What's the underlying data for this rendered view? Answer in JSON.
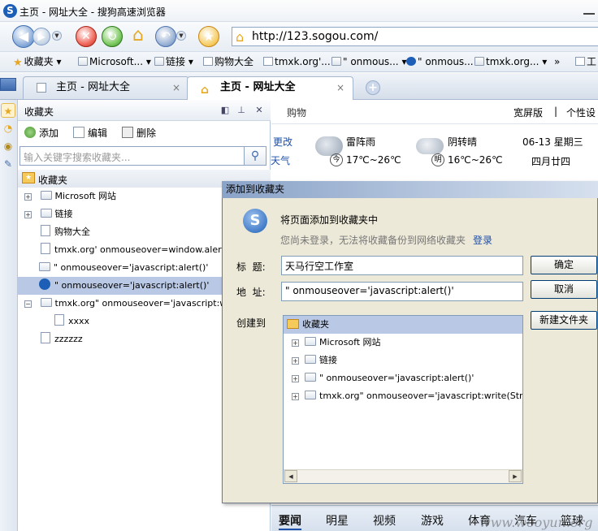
{
  "window": {
    "title": "主页 - 网址大全 - 搜狗高速浏览器"
  },
  "address": {
    "url": "http://123.sogou.com/"
  },
  "favbar": {
    "items": [
      "收藏夹",
      "Microsoft...",
      "链接",
      "购物大全",
      "tmxk.org'...",
      "\" onmous...",
      "\" onmous...",
      "tmxk.org...",
      "工"
    ]
  },
  "tabs": [
    {
      "label": "主页 - 网址大全",
      "close": "×"
    },
    {
      "label": "主页 - 网址大全",
      "close": "×"
    }
  ],
  "panel": {
    "title": "收藏夹",
    "tools": {
      "add": "添加",
      "edit": "编辑",
      "delete": "删除"
    },
    "search_placeholder": "输入关键字搜索收藏夹...",
    "root": "收藏夹",
    "items": [
      {
        "label": "Microsoft 网站",
        "kind": "folder",
        "expander": "+"
      },
      {
        "label": "链接",
        "kind": "folder",
        "expander": "+"
      },
      {
        "label": "购物大全",
        "kind": "page"
      },
      {
        "label": "tmxk.org' onmouseover=window.alert('chro",
        "kind": "page"
      },
      {
        "label": "\" onmouseover='javascript:alert()'",
        "kind": "folder"
      },
      {
        "label": "\" onmouseover='javascript:alert()'",
        "kind": "sogou",
        "selected": true
      },
      {
        "label": "tmxk.org\" onmouseover='javascript:write(S",
        "kind": "folder",
        "expander": "−"
      },
      {
        "label": "xxxx",
        "kind": "page",
        "indent": true
      },
      {
        "label": "zzzzzz",
        "kind": "page"
      }
    ]
  },
  "content": {
    "shopping": "购物",
    "wide": "宽屏版",
    "separator": "|",
    "personal": "个性设",
    "change": "更改",
    "weather_label": "天气",
    "day1": {
      "cond": "雷阵雨",
      "badge": "今",
      "temp": "17℃~26℃"
    },
    "day2": {
      "cond": "阴转晴",
      "badge": "明",
      "temp": "16℃~26℃"
    },
    "date": "06-13 星期三",
    "lunar": "四月廿四",
    "bottom_tabs": [
      "要闻",
      "明星",
      "视频",
      "游戏",
      "体育",
      "汽车",
      "篮球"
    ]
  },
  "dialog": {
    "title": "添加到收藏夹",
    "heading": "将页面添加到收藏夹中",
    "notice": "您尚未登录，无法将收藏备份到网络收藏夹",
    "login": "登录",
    "title_label": "标  题:",
    "title_value": "天马行空工作室",
    "addr_label": "地  址:",
    "addr_value": "\" onmouseover='javascript:alert()'",
    "create_label": "创建到",
    "ok": "确定",
    "cancel": "取消",
    "new_folder": "新建文件夹",
    "tree": [
      {
        "label": "收藏夹",
        "root": true
      },
      {
        "label": "Microsoft 网站",
        "expander": "+"
      },
      {
        "label": "链接",
        "expander": "+"
      },
      {
        "label": "\" onmouseover='javascript:alert()'",
        "expander": "+"
      },
      {
        "label": "tmxk.org\" onmouseover='javascript:write(String.fron",
        "expander": "+"
      }
    ]
  },
  "watermark": "www.wooyun.org"
}
